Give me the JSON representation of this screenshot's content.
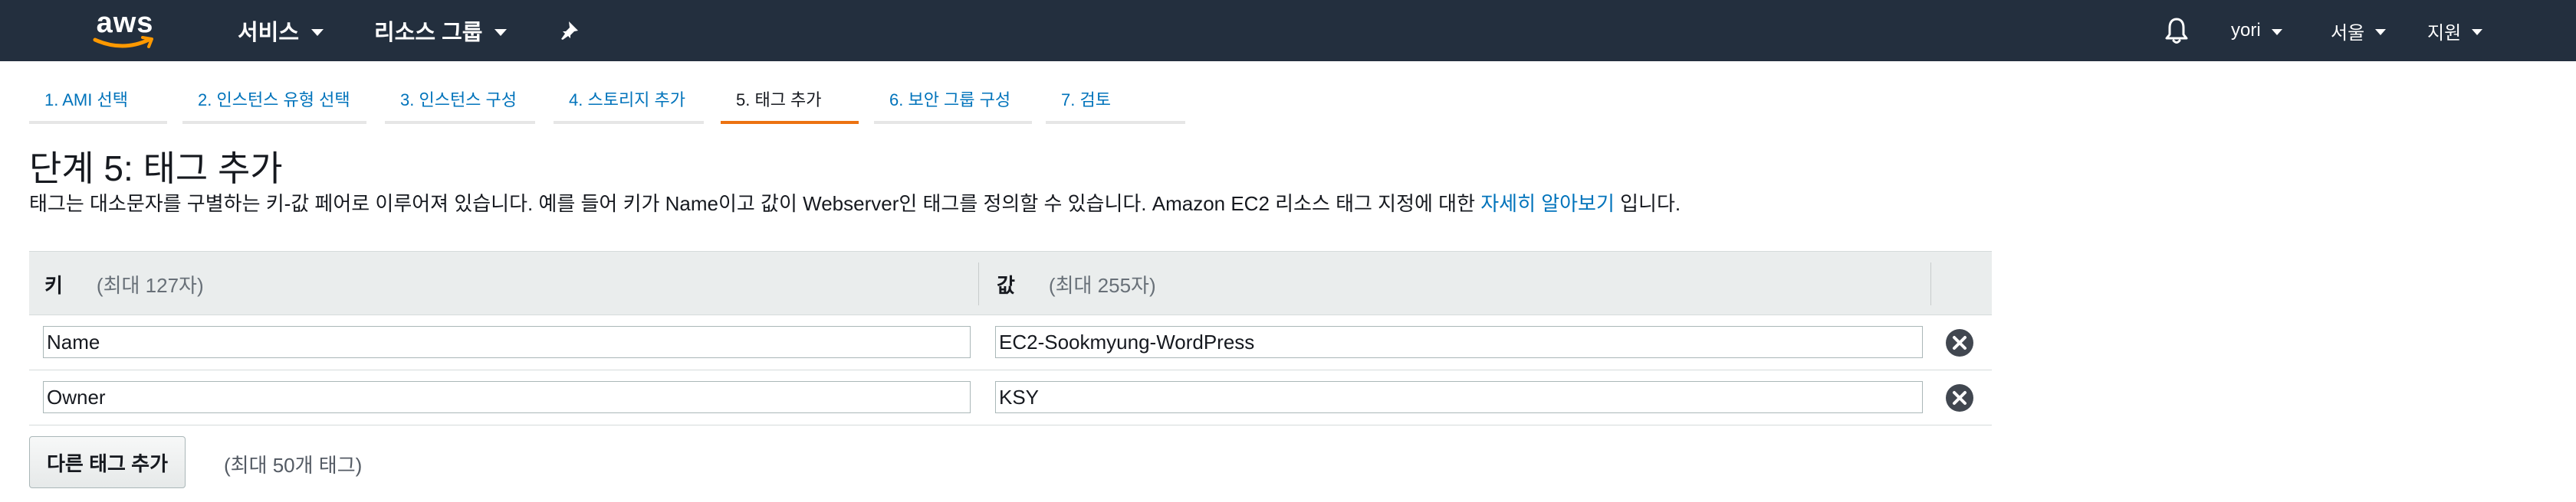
{
  "nav": {
    "logo": "aws",
    "services_label": "서비스",
    "resource_groups_label": "리소스 그룹",
    "user_label": "yori",
    "region_label": "서울",
    "support_label": "지원"
  },
  "steps": [
    {
      "label": "1. AMI 선택"
    },
    {
      "label": "2. 인스턴스 유형 선택"
    },
    {
      "label": "3. 인스턴스 구성"
    },
    {
      "label": "4. 스토리지 추가"
    },
    {
      "label": "5. 태그 추가",
      "active": true
    },
    {
      "label": "6. 보안 그룹 구성"
    },
    {
      "label": "7. 검토"
    }
  ],
  "page": {
    "title": "단계 5: 태그 추가",
    "description": "태그는 대소문자를 구별하는 키-값 페어로 이루어져 있습니다. 예를 들어 키가 Name이고 값이 Webserver인 태그를 정의할 수 있습니다. Amazon EC2 리소스 태그 지정에 대한 ",
    "learn_more_link": "자세히 알아보기",
    "description_suffix": "입니다."
  },
  "table": {
    "key_header": "키",
    "key_hint": "(최대 127자)",
    "value_header": "값",
    "value_hint": "(최대 255자)",
    "rows": [
      {
        "key": "Name",
        "value": "EC2-Sookmyung-WordPress"
      },
      {
        "key": "Owner",
        "value": "KSY"
      }
    ]
  },
  "add_tag": {
    "button_label": "다른 태그 추가",
    "hint": "(최대 50개 태그)"
  },
  "colors": {
    "nav_bg": "#232f3e",
    "link": "#0073bb",
    "active_step_underline": "#ec7211"
  }
}
